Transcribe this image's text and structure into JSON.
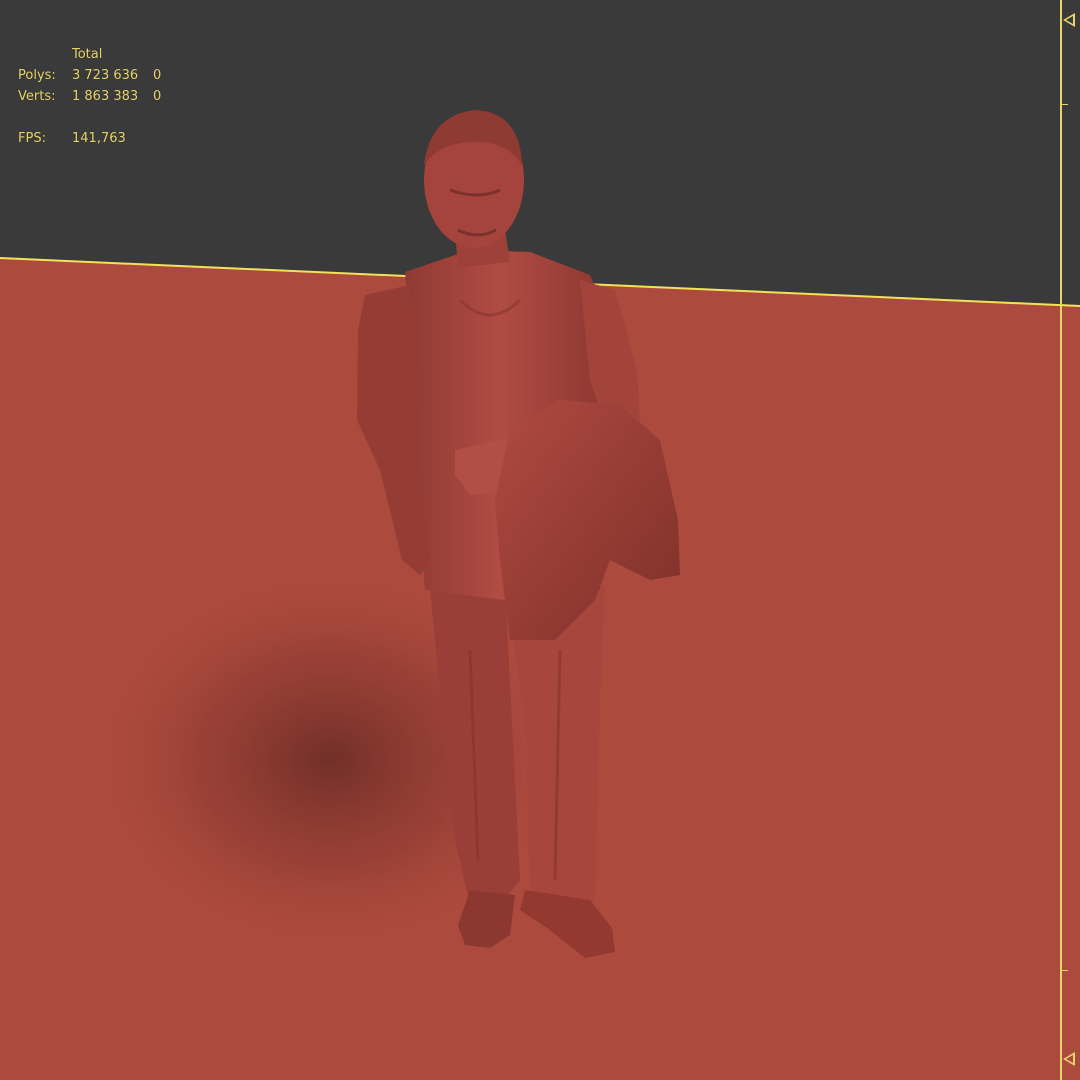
{
  "stats": {
    "header": "Total",
    "rows": [
      {
        "label": "Polys:",
        "v1": "3 723 636",
        "v2": "0"
      },
      {
        "label": "Verts:",
        "v1": "1 863 383",
        "v2": "0"
      }
    ],
    "fps_label": "FPS:",
    "fps_value": "141,763"
  },
  "colors": {
    "background": "#3a3a3a",
    "ground": "#ad4a3e",
    "overlay_text": "#e6d36a",
    "horizon_line": "#f0e35a",
    "figure": "#a5443c"
  },
  "icons": {
    "ruler_top_marker": "triangle-left-icon",
    "ruler_bottom_marker": "triangle-left-icon"
  }
}
